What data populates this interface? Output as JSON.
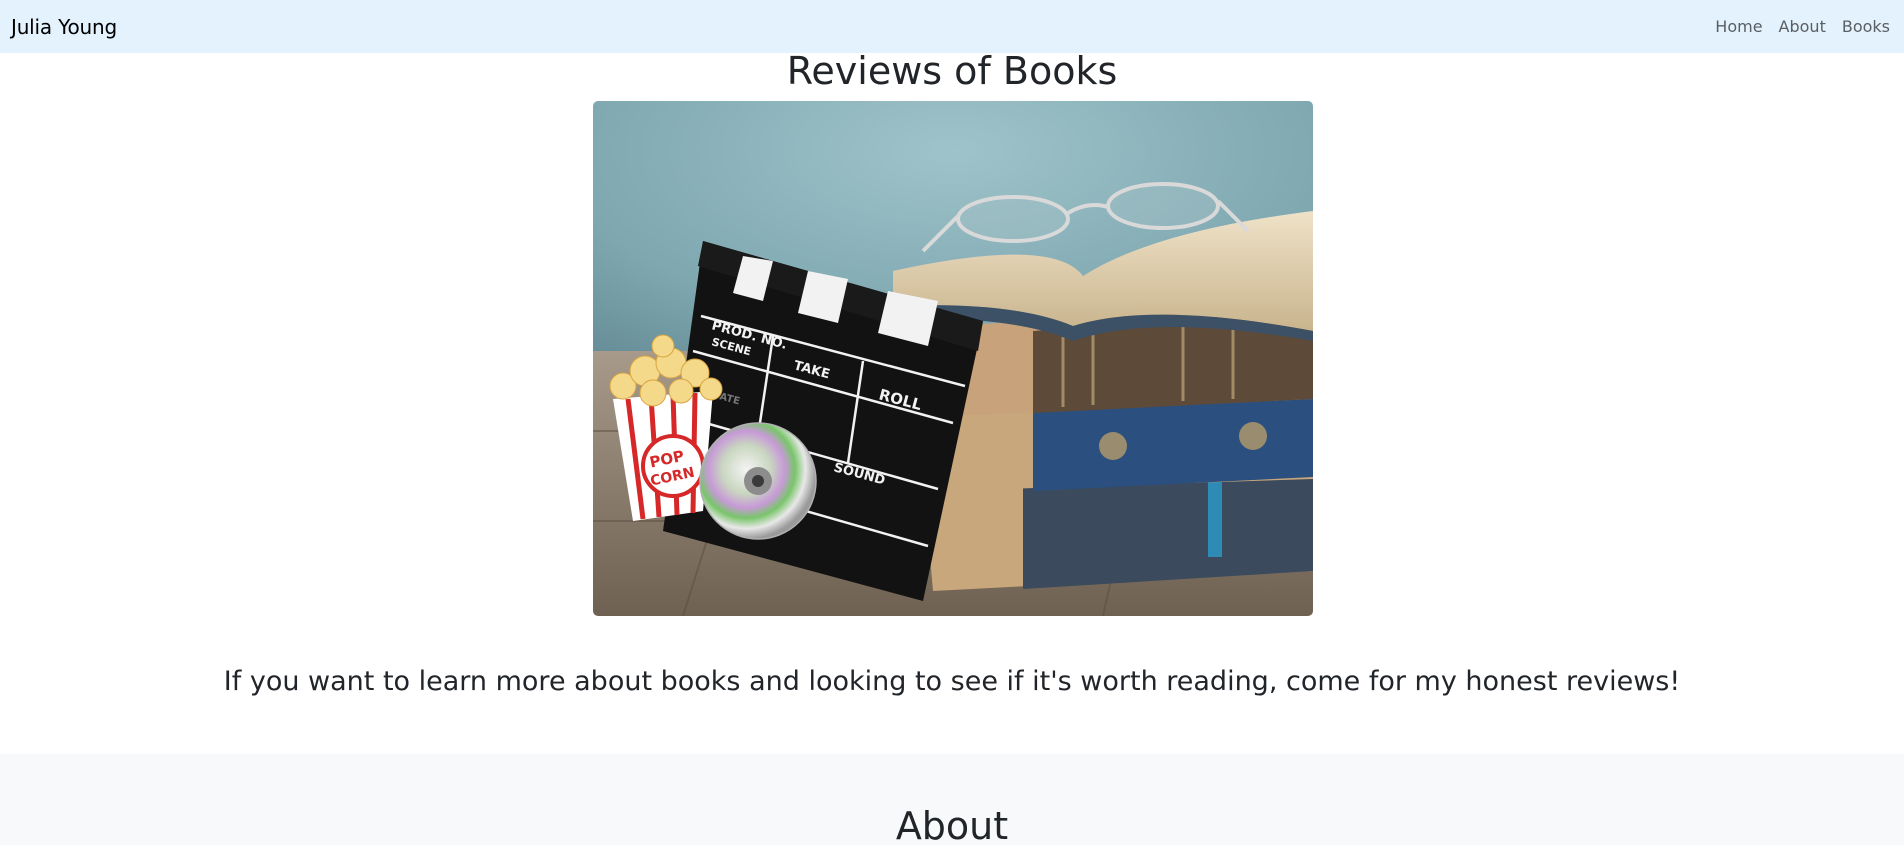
{
  "navbar": {
    "brand": "Julia Young",
    "links": [
      "Home",
      "About",
      "Books"
    ]
  },
  "hero": {
    "title": "Reviews of Books",
    "image_icon": "books-clapperboard-popcorn-image",
    "clapper_text": {
      "prod": "PROD. NO.",
      "scene": "SCENE",
      "take": "TAKE",
      "roll": "ROLL",
      "sound": "SOUND",
      "date": "DATE"
    },
    "popcorn_text": {
      "line1": "POP",
      "line2": "CORN"
    },
    "tagline": "If you want to learn more about books and looking to see if it's worth reading, come for my honest reviews!"
  },
  "about": {
    "heading": "About"
  },
  "colors": {
    "navbar_bg": "#e3f2fd",
    "section_bg": "#f8f9fa",
    "text": "#212529"
  }
}
